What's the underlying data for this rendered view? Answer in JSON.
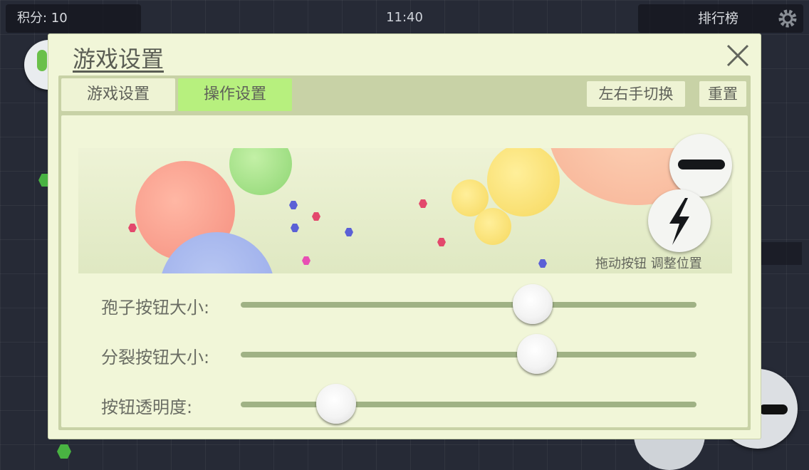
{
  "hud": {
    "score_text": "积分: 10",
    "time": "11:40",
    "leaderboard_label": "排行榜",
    "settings_icon": "gear-icon"
  },
  "dialog": {
    "title": "游戏设置",
    "close_icon": "close-icon",
    "tabs": [
      {
        "label": "游戏设置",
        "selected": false
      },
      {
        "label": "操作设置",
        "selected": true
      }
    ],
    "buttons": {
      "swap_hands": "左右手切换",
      "reset": "重置"
    },
    "preview": {
      "split_button_icon": "minus-icon",
      "spore_button_icon": "lightning-icon",
      "drag_hint": "拖动按钮 调整位置"
    },
    "sliders": [
      {
        "label": "孢子按钮大小:",
        "value_percent": 64
      },
      {
        "label": "分裂按钮大小:",
        "value_percent": 65
      },
      {
        "label": "按钮透明度:",
        "value_percent": 21
      }
    ]
  },
  "colors": {
    "dialog_bg": "#f1f6d8",
    "frame": "#c8d2a6",
    "tab_selected": "#b7f07e",
    "slider_track": "#a0b285"
  }
}
